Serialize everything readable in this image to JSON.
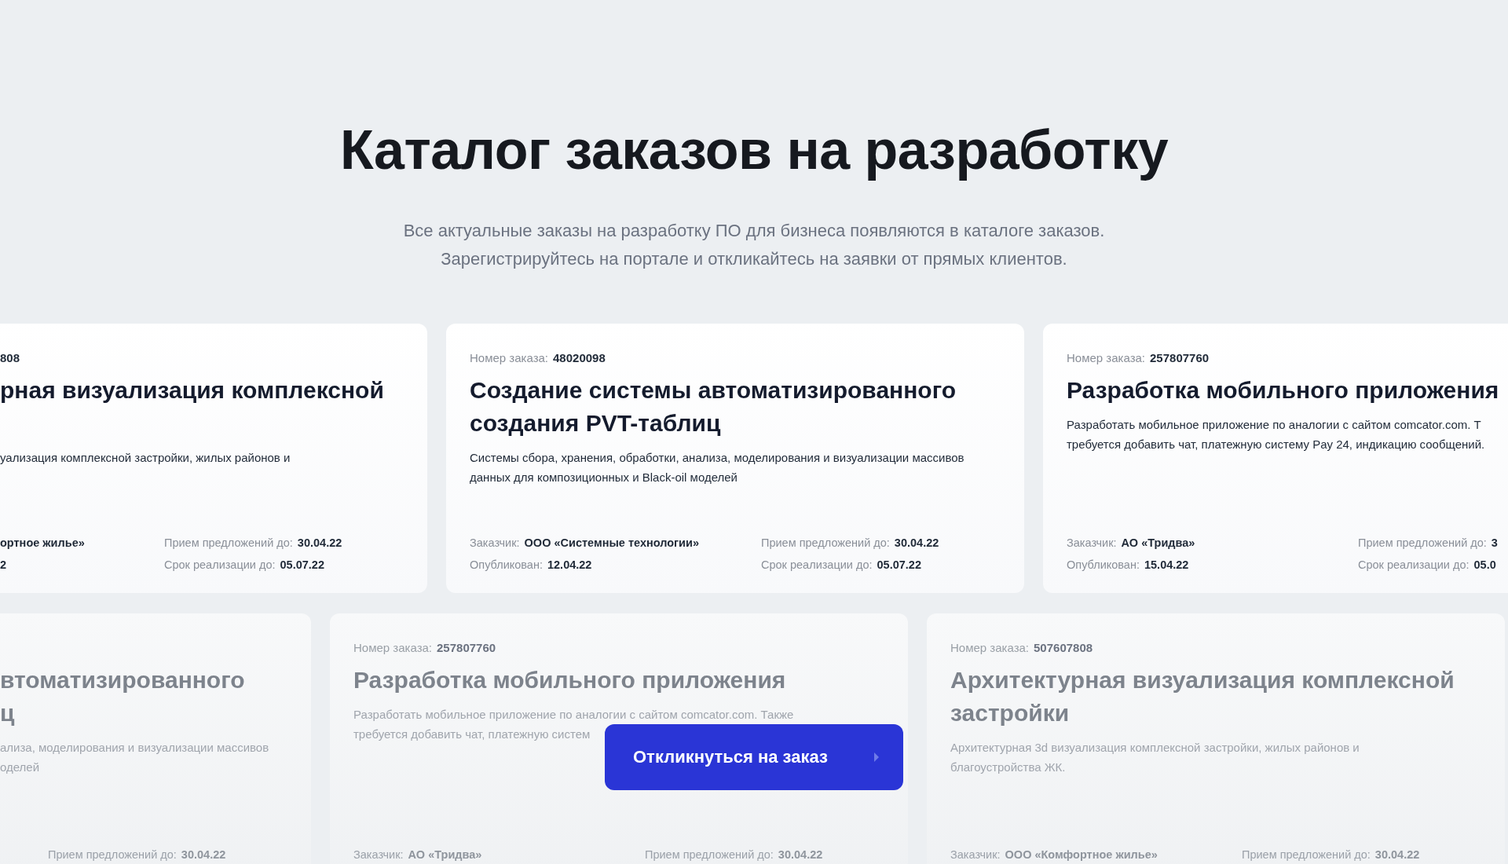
{
  "heading": "Каталог заказов на разработку",
  "subtitle": "Все актуальные заказы на разработку ПО для бизнеса появляются в каталоге заказов.\nЗарегистрируйтесь на портале и откликайтесь на заявки от прямых клиентов.",
  "card_rows": [
    {
      "cards": [
        {
          "faded": false,
          "order_number": {
            "value": "808"
          },
          "title": "рная визуализация комплексной",
          "description": "уализация комплексной застройки, жилых районов и",
          "meta": {
            "left": [
              {
                "value": "ортное жилье»"
              },
              {
                "value": "2"
              }
            ],
            "right": [
              {
                "label": "Прием предложений до:",
                "value": "30.04.22"
              },
              {
                "label": "Срок реализации до:",
                "value": "05.07.22"
              }
            ]
          }
        },
        {
          "faded": false,
          "order_number": {
            "label": "Номер заказа:",
            "value": "48020098"
          },
          "title": "Создание системы автоматизированного\nсоздания PVT-таблиц",
          "description": "Системы сбора, хранения, обработки, анализа, моделирования и визуализации массивов\nданных для композиционных и Black-oil моделей",
          "meta": {
            "left": [
              {
                "label": "Заказчик:",
                "value": "ООО «Системные технологии»"
              },
              {
                "label": "Опубликован:",
                "value": "12.04.22"
              }
            ],
            "right": [
              {
                "label": "Прием предложений до:",
                "value": "30.04.22"
              },
              {
                "label": "Срок реализации до:",
                "value": "05.07.22"
              }
            ]
          }
        },
        {
          "faded": false,
          "order_number": {
            "label": "Номер заказа:",
            "value": "257807760"
          },
          "title": "Разработка мобильного приложения",
          "description": "Разработать мобильное приложение по аналогии с сайтом comcator.com. Т\nтребуется добавить чат, платежную систему Pay 24, индикацию сообщений.",
          "meta": {
            "left": [
              {
                "label": "Заказчик:",
                "value": "АО «Тридва»"
              },
              {
                "label": "Опубликован:",
                "value": "15.04.22"
              }
            ],
            "right": [
              {
                "label": "Прием предложений до:",
                "value": "3"
              },
              {
                "label": "Срок реализации до:",
                "value": "05.0"
              }
            ]
          }
        }
      ]
    },
    {
      "cards": [
        {
          "faded": true,
          "title": "втоматизированного\nц",
          "description": "ализа, моделирования и визуализации массивов\nоделей",
          "meta": {
            "right": [
              {
                "label": "Прием предложений до:",
                "value": "30.04.22"
              }
            ]
          }
        },
        {
          "faded": true,
          "order_number": {
            "label": "Номер заказа:",
            "value": "257807760"
          },
          "title": "Разработка мобильного приложения",
          "description": "Разработать мобильное приложение по аналогии с сайтом comcator.com. Также\nтребуется добавить чат, платежную систем",
          "meta": {
            "left": [
              {
                "label": "Заказчик:",
                "value": "АО «Тридва»"
              }
            ],
            "right": [
              {
                "label": "Прием предложений до:",
                "value": "30.04.22"
              }
            ]
          }
        },
        {
          "faded": true,
          "order_number": {
            "label": "Номер заказа:",
            "value": "507607808"
          },
          "title": "Архитектурная визуализация комплексной\nзастройки",
          "description": "Архитектурная 3d визуализация комплексной застройки, жилых районов и\nблагоустройства ЖК.",
          "meta": {
            "left": [
              {
                "label": "Заказчик:",
                "value": "ООО «Комфортное жилье»"
              }
            ],
            "right": [
              {
                "label": "Прием предложений до:",
                "value": "30.04.22"
              }
            ]
          }
        }
      ]
    }
  ],
  "respond_button": {
    "label": "Откликнуться на заказ"
  }
}
